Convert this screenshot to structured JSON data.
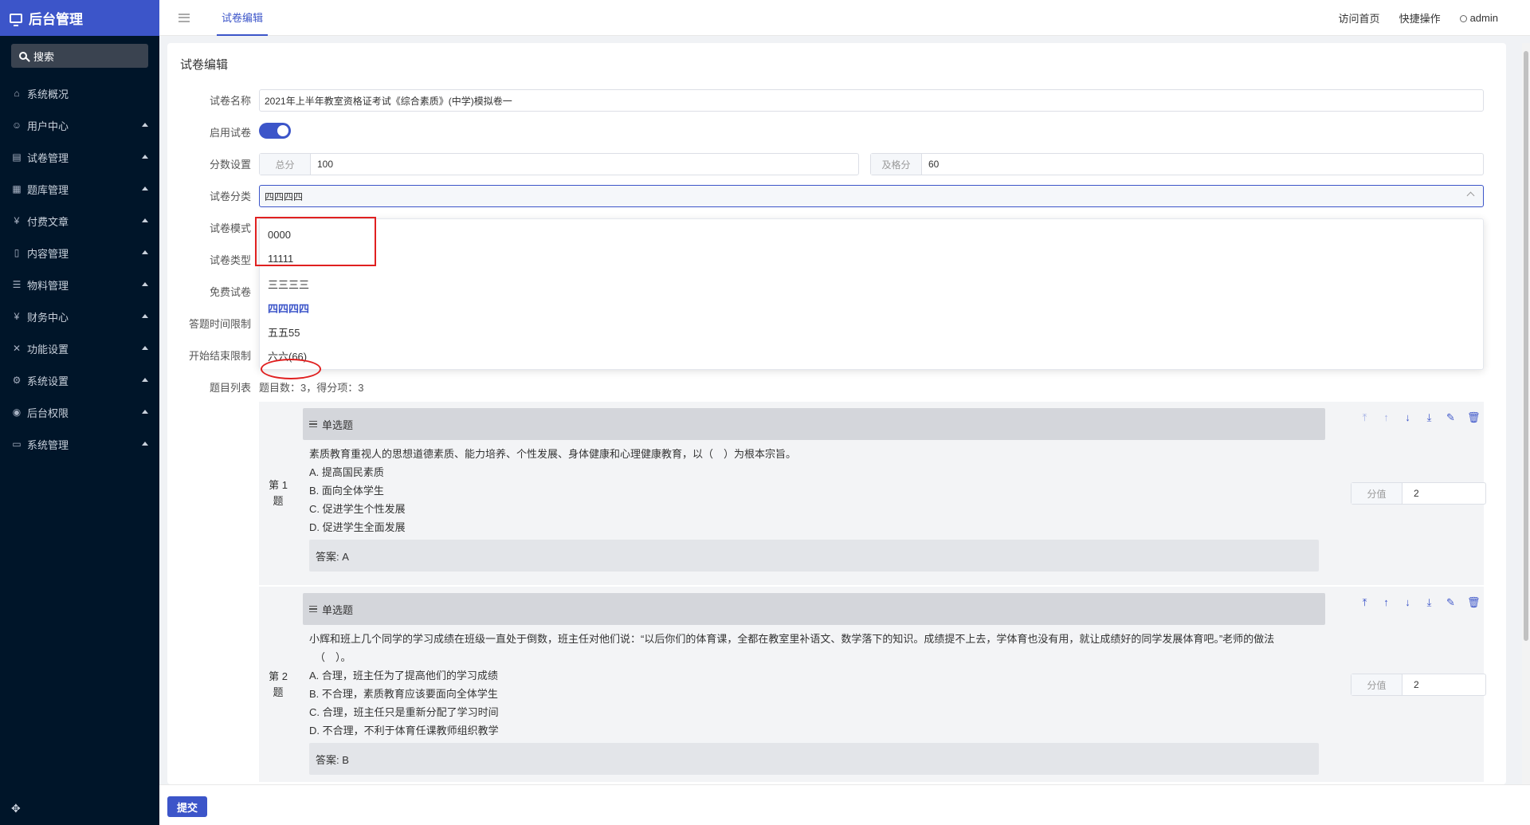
{
  "sidebar": {
    "brand": "后台管理",
    "search": "搜索",
    "items": [
      {
        "label": "系统概况",
        "icon": "home-icon",
        "glyph": "⌂",
        "caret": false
      },
      {
        "label": "用户中心",
        "icon": "user-center-icon",
        "glyph": "☺",
        "caret": true
      },
      {
        "label": "试卷管理",
        "icon": "paper-icon",
        "glyph": "▤",
        "caret": true
      },
      {
        "label": "题库管理",
        "icon": "question-bank-icon",
        "glyph": "▦",
        "caret": true
      },
      {
        "label": "付费文章",
        "icon": "yen-icon",
        "glyph": "¥",
        "caret": true
      },
      {
        "label": "内容管理",
        "icon": "document-icon",
        "glyph": "▯",
        "caret": true
      },
      {
        "label": "物料管理",
        "icon": "list-icon",
        "glyph": "☰",
        "caret": true
      },
      {
        "label": "财务中心",
        "icon": "yen-icon",
        "glyph": "¥",
        "caret": true
      },
      {
        "label": "功能设置",
        "icon": "tools-icon",
        "glyph": "✕",
        "caret": true
      },
      {
        "label": "系统设置",
        "icon": "gear-icon",
        "glyph": "⚙",
        "caret": true
      },
      {
        "label": "后台权限",
        "icon": "user-circle-icon",
        "glyph": "◉",
        "caret": true
      },
      {
        "label": "系统管理",
        "icon": "monitor-icon",
        "glyph": "▭",
        "caret": true
      }
    ],
    "bottom_glyph": "✥"
  },
  "header": {
    "active_tab": "试卷编辑",
    "links": [
      "访问首页",
      "快捷操作"
    ],
    "user": "admin"
  },
  "form": {
    "title": "试卷编辑",
    "name_label": "试卷名称",
    "name_value": "2021年上半年教室资格证考试《综合素质》(中学)模拟卷一",
    "enable_label": "启用试卷",
    "score_label": "分数设置",
    "total_addon": "总分",
    "total_value": "100",
    "pass_addon": "及格分",
    "pass_value": "60",
    "category_label": "试卷分类",
    "category_value": "四四四四",
    "mode_label": "试卷模式",
    "type_label": "试卷类型",
    "free_label": "免费试卷",
    "time_label": "答题时间限制",
    "start_end_label": "开始结束限制",
    "list_label": "题目列表",
    "list_summary": "题目数：3，得分项：3"
  },
  "dropdown": {
    "options": [
      "0000",
      "11111",
      "三三三三",
      "四四四四",
      "五五55",
      "六六(66)"
    ],
    "selected": 3
  },
  "questions": [
    {
      "num_line1": "第 1",
      "num_line2": "题",
      "type": "单选题",
      "text": "素质教育重视人的思想道德素质、能力培养、个性发展、身体健康和心理健康教育，以（　）为根本宗旨。",
      "text2": "",
      "options": [
        "A.  提高国民素质",
        "B.  面向全体学生",
        "C.  促进学生个性发展",
        "D.  促进学生全面发展"
      ],
      "answer": "答案: A",
      "score_addon": "分值",
      "score": "2"
    },
    {
      "num_line1": "第 2",
      "num_line2": "题",
      "type": "单选题",
      "text": "小辉和班上几个同学的学习成绩在班级一直处于倒数，班主任对他们说：“以后你们的体育课，全都在教室里补语文、数学落下的知识。成绩提不上去，学体育也没有用，就让成绩好的同学发展体育吧。”老师的做法",
      "text2": "（　）。",
      "options": [
        "A.  合理，班主任为了提高他们的学习成绩",
        "B.  不合理，素质教育应该要面向全体学生",
        "C.  合理，班主任只是重新分配了学习时间",
        "D.  不合理，不利于体育任课教师组织教学"
      ],
      "answer": "答案: B",
      "score_addon": "分值",
      "score": "2"
    }
  ],
  "tool_icons": [
    "⤒",
    "↑",
    "↓",
    "⤓",
    "✎",
    "🗑"
  ],
  "footer": {
    "submit": "提交"
  }
}
